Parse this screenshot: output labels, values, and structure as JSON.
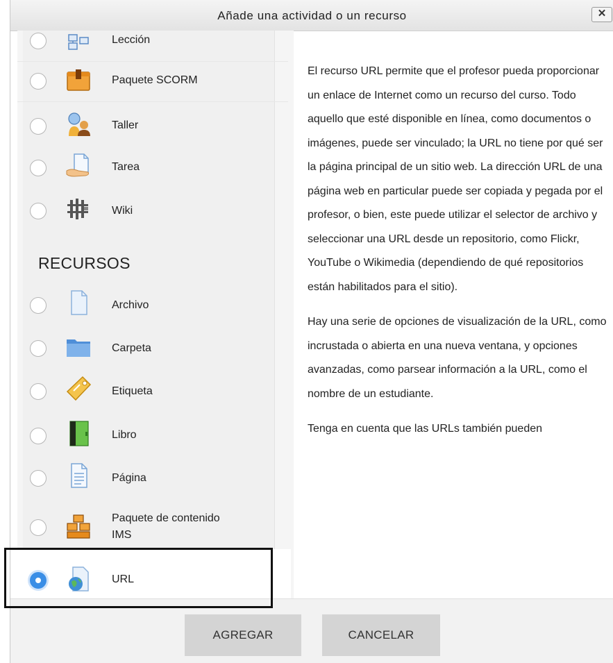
{
  "dialog": {
    "title": "Añade una actividad o un recurso",
    "close_label": "✕"
  },
  "activities": [
    {
      "label": "Lección",
      "icon": "lesson-icon"
    },
    {
      "label": "Paquete SCORM",
      "icon": "scorm-package-icon"
    },
    {
      "label": "Taller",
      "icon": "workshop-icon"
    },
    {
      "label": "Tarea",
      "icon": "assignment-icon"
    },
    {
      "label": "Wiki",
      "icon": "wiki-icon"
    }
  ],
  "resources_heading": "RECURSOS",
  "resources": [
    {
      "label": "Archivo",
      "icon": "file-icon"
    },
    {
      "label": "Carpeta",
      "icon": "folder-icon"
    },
    {
      "label": "Etiqueta",
      "icon": "label-tag-icon"
    },
    {
      "label": "Libro",
      "icon": "book-icon"
    },
    {
      "label": "Página",
      "icon": "page-icon"
    },
    {
      "label_line1": "Paquete de contenido",
      "label_line2": "IMS",
      "icon": "ims-package-icon"
    },
    {
      "label": "URL",
      "icon": "url-globe-icon",
      "selected": true
    }
  ],
  "description": [
    "El recurso URL permite que el profesor pueda proporcionar un enlace de Internet como un recurso del curso. Todo aquello que esté disponible en línea, como documentos o imágenes, puede ser vinculado; la URL no tiene por qué ser la página principal de un sitio web. La dirección URL de una página web en particular puede ser copiada y pegada por el profesor, o bien, este puede utilizar el selector de archivo y seleccionar una URL desde un repositorio, como Flickr, YouTube o Wikimedia (dependiendo de qué repositorios están habilitados para el sitio).",
    "Hay una serie de opciones de visualización de la URL, como incrustada o abierta en una nueva ventana, y opciones avanzadas, como parsear información a la URL, como el nombre de un estudiante.",
    "Tenga en cuenta que las URLs también pueden"
  ],
  "footer": {
    "add_label": "AGREGAR",
    "cancel_label": "CANCELAR"
  }
}
